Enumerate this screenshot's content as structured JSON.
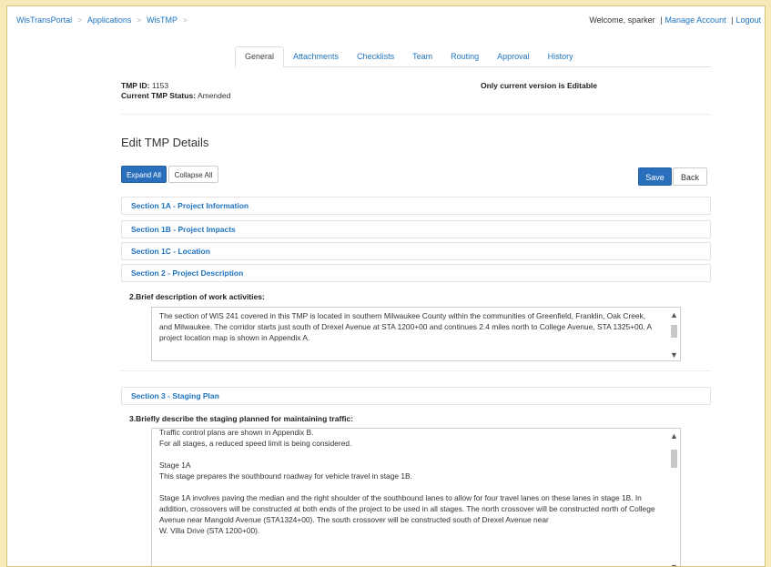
{
  "breadcrumb": {
    "items": [
      "WisTransPortal",
      "Applications",
      "WisTMP"
    ],
    "separator": ">"
  },
  "account": {
    "welcome": "Welcome, sparker",
    "separator": "|",
    "manage": "Manage Account",
    "logout": "Logout"
  },
  "tabs": [
    {
      "label": "General",
      "active": true
    },
    {
      "label": "Attachments",
      "active": false
    },
    {
      "label": "Checklists",
      "active": false
    },
    {
      "label": "Team",
      "active": false
    },
    {
      "label": "Routing",
      "active": false
    },
    {
      "label": "Approval",
      "active": false
    },
    {
      "label": "History",
      "active": false
    }
  ],
  "tmp": {
    "id_label": "TMP ID:",
    "id_value": "1153",
    "status_label": "Current TMP Status:",
    "status_value": "Amended",
    "editable_note": "Only current version is Editable"
  },
  "page_title": "Edit TMP Details",
  "buttons": {
    "expand_all": "Expand All",
    "collapse_all": "Collapse All",
    "save": "Save",
    "back": "Back"
  },
  "sections": {
    "s1a": "Section 1A - Project Information",
    "s1b": "Section 1B - Project Impacts",
    "s1c": "Section 1C - Location",
    "s2": "Section 2 - Project Description",
    "s3": "Section 3 - Staging Plan"
  },
  "q2": {
    "label": "2.Brief description of work activities:",
    "text": "The section of WIS 241 covered in this TMP is located in southern Milwaukee County within the communities of Greenfield, Franklin, Oak Creek, and Milwaukee.  The corridor starts just south of Drexel Avenue at STA 1200+00 and continues 2.4 miles north to College Avenue, STA 1325+00.  A project location map is shown in Appendix A."
  },
  "q3": {
    "label": "3.Briefly describe the staging planned for maintaining traffic:",
    "text": "Traffic control plans are shown in Appendix B.\nFor all stages, a reduced speed limit is being considered.\n\nStage 1A\nThis stage prepares the southbound roadway for vehicle travel in stage 1B.\n\nStage 1A involves paving the median and the right shoulder of the southbound lanes to allow for four travel lanes on these lanes in stage 1B.  In addition, crossovers will be constructed at both ends of the project to be used in all stages.  The north crossover will be constructed north of College Avenue near Mangold Avenue (STA1324+00).  The south crossover will be constructed south of Drexel Avenue near\nW. Villa Drive (STA 1200+00)."
  },
  "icons": {
    "scroll_up": "chevron-up-icon",
    "scroll_down": "chevron-down-icon"
  },
  "colors": {
    "background": "#f7e9b8",
    "link": "#1e73be",
    "primary_button": "#2a6fbb"
  }
}
